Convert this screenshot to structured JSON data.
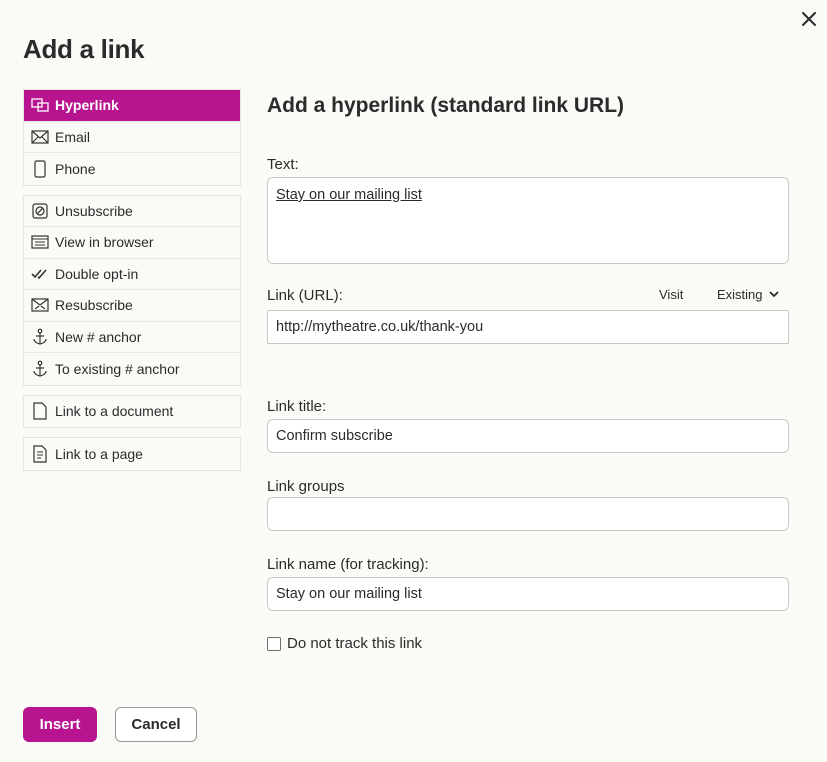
{
  "dialog": {
    "title": "Add a link",
    "heading": "Add a hyperlink (standard link URL)"
  },
  "sidebar": {
    "groups": [
      [
        {
          "label": "Hyperlink",
          "icon": "hyperlink-icon",
          "active": true
        },
        {
          "label": "Email",
          "icon": "envelope-icon"
        },
        {
          "label": "Phone",
          "icon": "phone-icon"
        }
      ],
      [
        {
          "label": "Unsubscribe",
          "icon": "unsubscribe-icon"
        },
        {
          "label": "View in browser",
          "icon": "browser-icon"
        },
        {
          "label": "Double opt-in",
          "icon": "double-check-icon"
        },
        {
          "label": "Resubscribe",
          "icon": "resubscribe-icon"
        },
        {
          "label": "New # anchor",
          "icon": "anchor-icon"
        },
        {
          "label": "To existing # anchor",
          "icon": "anchor-icon"
        }
      ],
      [
        {
          "label": "Link to a document",
          "icon": "document-icon"
        }
      ],
      [
        {
          "label": "Link to a page",
          "icon": "page-icon"
        }
      ]
    ]
  },
  "form": {
    "text_label": "Text:",
    "text_value": "Stay on our mailing list",
    "url_label": "Link (URL):",
    "visit_label": "Visit",
    "existing_label": "Existing",
    "url_value": "http://mytheatre.co.uk/thank-you",
    "title_label": "Link title:",
    "title_value": "Confirm subscribe",
    "groups_label": "Link groups",
    "groups_value": "",
    "name_label": "Link name (for tracking):",
    "name_value": "Stay on our mailing list",
    "no_track_label": "Do not track this link"
  },
  "buttons": {
    "insert": "Insert",
    "cancel": "Cancel"
  },
  "colors": {
    "accent": "#b9148f",
    "background": "#fafaf7"
  }
}
